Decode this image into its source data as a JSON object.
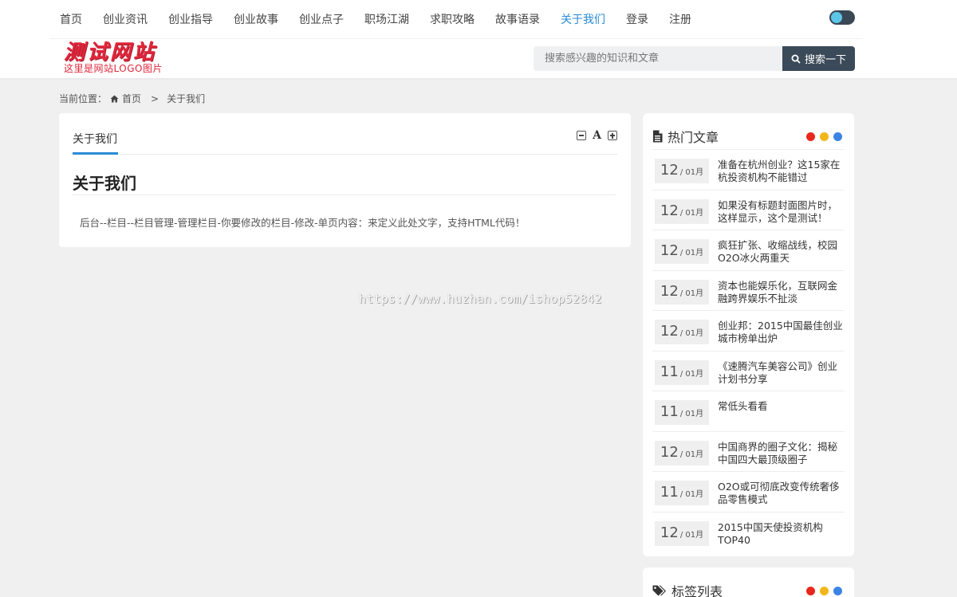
{
  "nav": {
    "items": [
      "首页",
      "创业资讯",
      "创业指导",
      "创业故事",
      "创业点子",
      "职场江湖",
      "求职攻略",
      "故事语录",
      "关于我们",
      "登录",
      "注册"
    ],
    "active_index": 8
  },
  "logo": {
    "main": "测试网站",
    "sub": "这里是网站LOGO图片"
  },
  "search": {
    "placeholder": "搜索感兴趣的知识和文章",
    "button_label": "搜索一下"
  },
  "breadcrumb": {
    "prefix": "当前位置：",
    "home": "首页",
    "separator": ">",
    "current": "关于我们"
  },
  "article": {
    "tab_label": "关于我们",
    "title": "关于我们",
    "body": "后台--栏目--栏目管理-管理栏目-你要修改的栏目-修改-单页内容：来定义此处文字，支持HTML代码！"
  },
  "watermark": "https://www.huzhan.com/ishop52842",
  "hot_articles": {
    "heading": "热门文章",
    "dot_colors": [
      "#e8281d",
      "#f2b619",
      "#3b84e6"
    ],
    "items": [
      {
        "day": "12",
        "month": "/ 01月",
        "title": "准备在杭州创业？这15家在杭投资机构不能错过"
      },
      {
        "day": "12",
        "month": "/ 01月",
        "title": "如果没有标题封面图片时，这样显示，这个是测试！"
      },
      {
        "day": "12",
        "month": "/ 01月",
        "title": "疯狂扩张、收缩战线，校园O2O冰火两重天"
      },
      {
        "day": "12",
        "month": "/ 01月",
        "title": "资本也能娱乐化，互联网金融跨界娱乐不扯淡"
      },
      {
        "day": "12",
        "month": "/ 01月",
        "title": "创业邦：2015中国最佳创业城市榜单出炉"
      },
      {
        "day": "11",
        "month": "/ 01月",
        "title": "《速腾汽车美容公司》创业计划书分享"
      },
      {
        "day": "11",
        "month": "/ 01月",
        "title": "常低头看看"
      },
      {
        "day": "12",
        "month": "/ 01月",
        "title": "中国商界的圈子文化：揭秘中国四大最顶级圈子"
      },
      {
        "day": "11",
        "month": "/ 01月",
        "title": "O2O或可彻底改变传统奢侈品零售模式"
      },
      {
        "day": "12",
        "month": "/ 01月",
        "title": "2015中国天使投资机构TOP40"
      }
    ]
  },
  "tags": {
    "heading": "标签列表",
    "dot_colors": [
      "#e8281d",
      "#f2b619",
      "#3b84e6"
    ]
  },
  "colors": {
    "accent": "#2b8bd6",
    "search_button": "#3b4a58",
    "logo_red": "#e0263b"
  }
}
